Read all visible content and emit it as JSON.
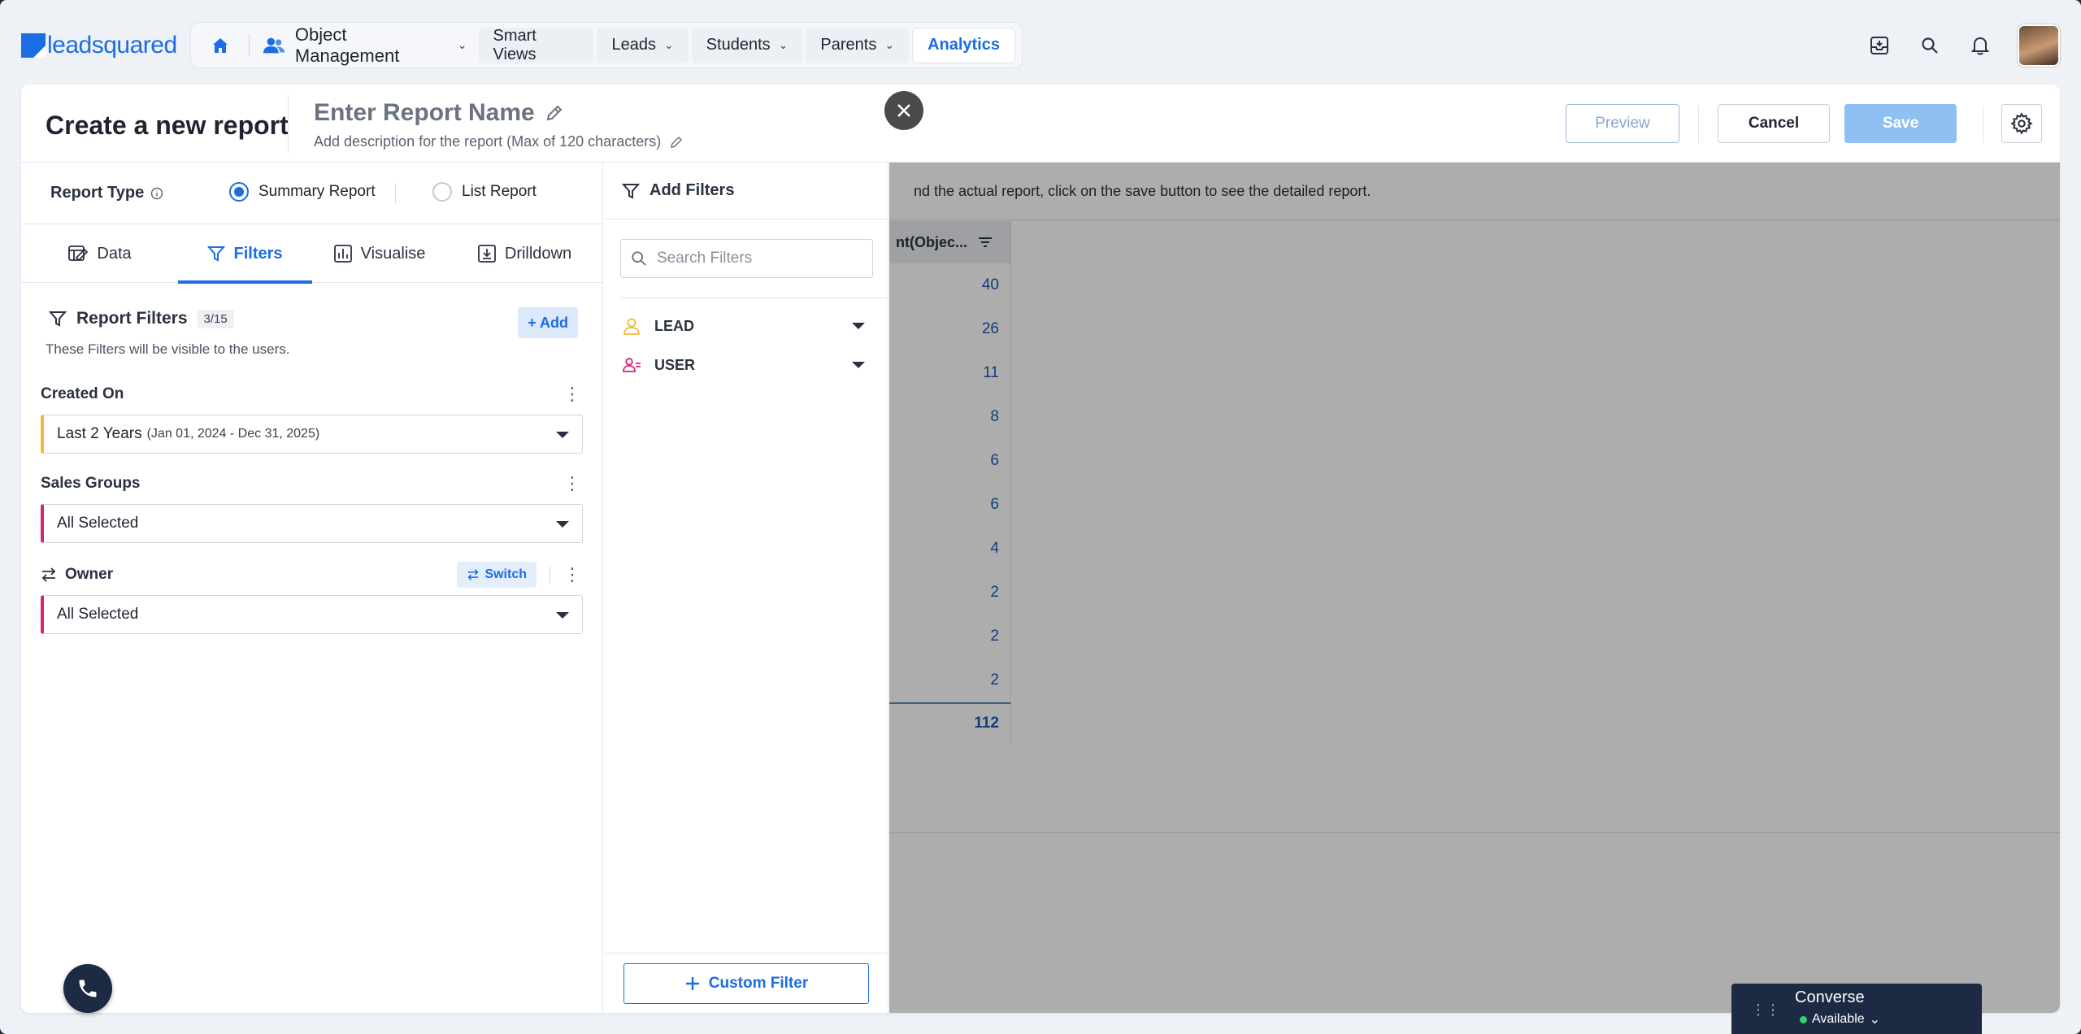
{
  "brand": {
    "name_a": "lead",
    "name_b": "squared"
  },
  "nav": {
    "object_management": "Object Management",
    "items": [
      {
        "label": "Smart Views",
        "chevron": false
      },
      {
        "label": "Leads",
        "chevron": true
      },
      {
        "label": "Students",
        "chevron": true
      },
      {
        "label": "Parents",
        "chevron": true
      },
      {
        "label": "Analytics",
        "chevron": false,
        "active": true
      }
    ]
  },
  "header": {
    "page_title": "Create a new report",
    "report_name_placeholder": "Enter Report Name",
    "description_placeholder": "Add description for the report (Max of 120 characters)",
    "preview": "Preview",
    "cancel": "Cancel",
    "save": "Save"
  },
  "report_type": {
    "label": "Report Type",
    "options": [
      {
        "label": "Summary Report",
        "selected": true
      },
      {
        "label": "List Report",
        "selected": false
      }
    ]
  },
  "tabs": [
    {
      "label": "Data",
      "icon": "data-icon"
    },
    {
      "label": "Filters",
      "icon": "filter-icon",
      "active": true
    },
    {
      "label": "Visualise",
      "icon": "chart-icon"
    },
    {
      "label": "Drilldown",
      "icon": "drilldown-icon"
    }
  ],
  "report_filters": {
    "title": "Report Filters",
    "count": "3/15",
    "add": "+ Add",
    "subtitle": "These Filters will be visible to the users.",
    "filters": [
      {
        "label": "Created On",
        "value": "Last 2 Years",
        "detail": "(Jan 01, 2024 - Dec 31, 2025)",
        "accent": "#f2b83b"
      },
      {
        "label": "Sales Groups",
        "value": "All Selected",
        "detail": "",
        "accent": "#d6237a"
      },
      {
        "label": "Owner",
        "value": "All Selected",
        "detail": "",
        "accent": "#d6237a",
        "switch": "Switch"
      }
    ]
  },
  "add_filters": {
    "title": "Add Filters",
    "search_placeholder": "Search Filters",
    "categories": [
      {
        "label": "LEAD",
        "icon": "lead-user-icon",
        "color": "#f2b83b"
      },
      {
        "label": "USER",
        "icon": "user-group-icon",
        "color": "#d6237a"
      }
    ],
    "custom_filter": "Custom Filter"
  },
  "preview": {
    "note": "nd the actual report, click on the save button to see the detailed report.",
    "column_header": "nt(Objec...",
    "values": [
      "40",
      "26",
      "11",
      "8",
      "6",
      "6",
      "4",
      "2",
      "2",
      "2"
    ],
    "total": "112"
  },
  "converse": {
    "title": "Converse",
    "status": "Available"
  }
}
